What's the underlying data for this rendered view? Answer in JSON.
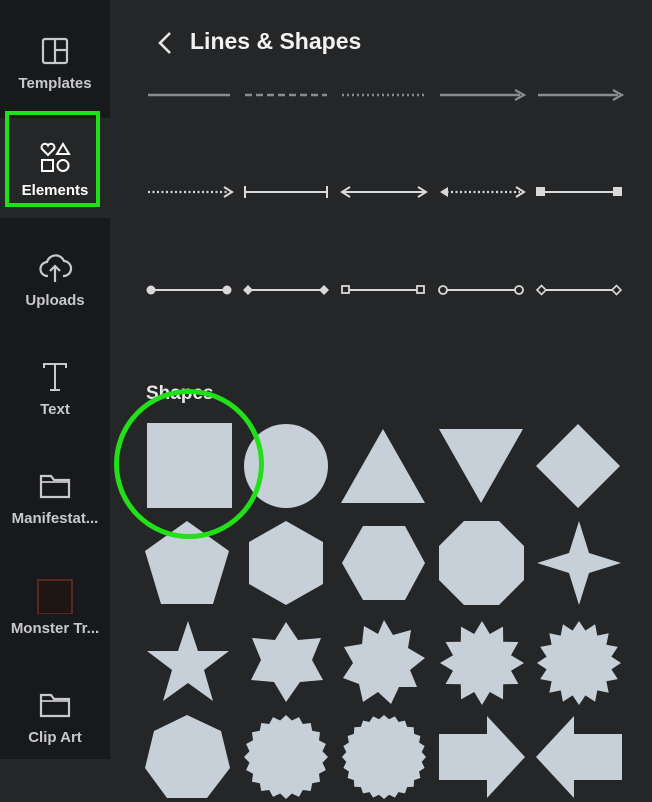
{
  "sidebar": {
    "items": [
      {
        "label": "Templates",
        "icon": "templates-icon"
      },
      {
        "label": "Elements",
        "icon": "elements-icon"
      },
      {
        "label": "Uploads",
        "icon": "uploads-icon"
      },
      {
        "label": "Text",
        "icon": "text-icon"
      },
      {
        "label": "Manifestat...",
        "icon": "folder-icon"
      },
      {
        "label": "Monster Tr...",
        "icon": "thumbnail-icon"
      },
      {
        "label": "Clip Art",
        "icon": "folder-icon"
      }
    ],
    "active_item": "Elements"
  },
  "panel": {
    "back_icon": "chevron-left-icon",
    "title": "Lines & Shapes",
    "lines": [
      [
        "solid-line",
        "dashed-line",
        "dotted-line",
        "arrow-line",
        "arrow-line"
      ],
      [
        "dotted-arrow-line",
        "bar-end-line",
        "double-arrow-line",
        "dotted-double-arrow-line",
        "square-end-line"
      ],
      [
        "circle-end-line",
        "diamond-end-line",
        "hollow-square-end-line",
        "hollow-circle-end-line",
        "hollow-diamond-end-line"
      ]
    ],
    "shapes_heading": "Shapes",
    "shapes": [
      [
        "square",
        "circle",
        "triangle",
        "inverted-triangle",
        "diamond"
      ],
      [
        "pentagon",
        "hexagon",
        "hexagon-flat",
        "octagon",
        "four-point-star"
      ],
      [
        "five-point-star",
        "six-point-star",
        "eight-point-star",
        "twelve-point-star",
        "sixteen-point-star"
      ],
      [
        "heptagon",
        "seal",
        "seal",
        "arrow-right",
        "arrow-left"
      ]
    ]
  },
  "colors": {
    "sidebar_bg": "#18191b",
    "panel_bg": "#252627",
    "shape_fill": "#c7d0d9",
    "line_color": "#d9d9d9",
    "highlight": "#22e017"
  }
}
